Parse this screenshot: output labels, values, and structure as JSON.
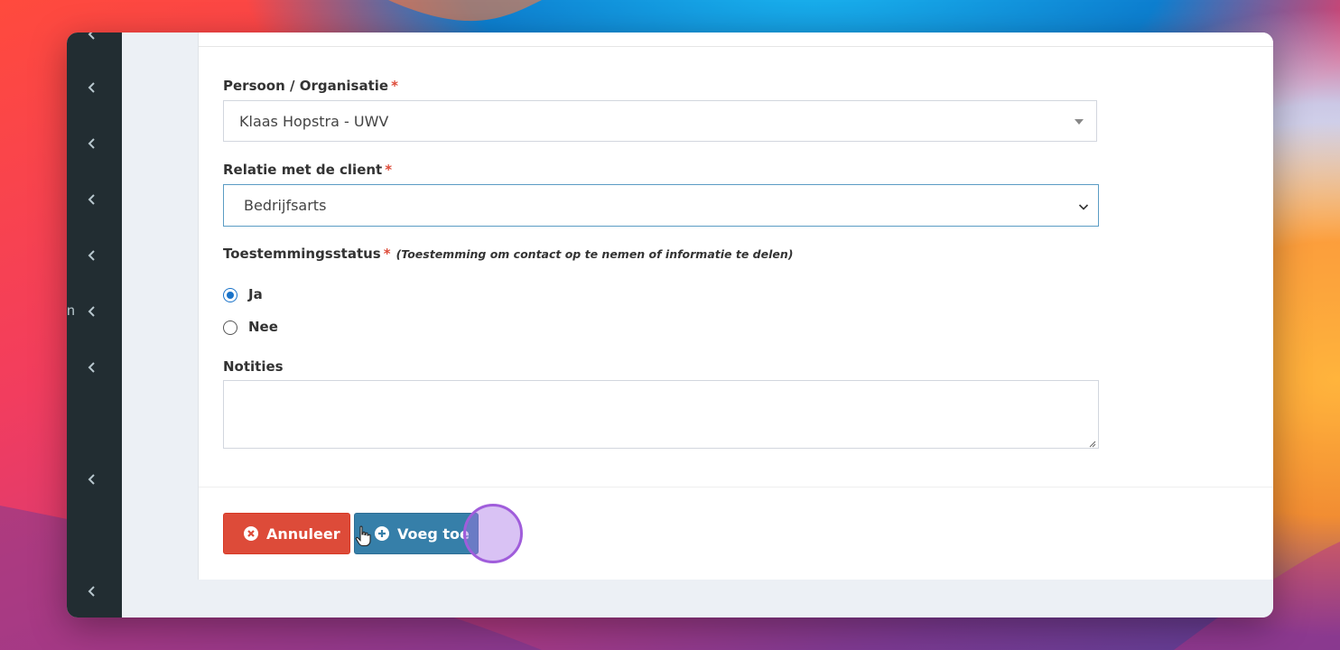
{
  "sidebar": {
    "clipped_text": "n",
    "items": [
      {
        "icon": "chevron-left-icon"
      },
      {
        "icon": "chevron-left-icon"
      },
      {
        "icon": "chevron-left-icon"
      },
      {
        "icon": "chevron-left-icon"
      },
      {
        "icon": "chevron-left-icon"
      },
      {
        "icon": "chevron-left-icon"
      },
      {
        "icon": "chevron-left-icon"
      },
      {
        "icon": "chevron-left-icon"
      },
      {
        "icon": "chevron-left-icon"
      }
    ]
  },
  "form": {
    "person": {
      "label": "Persoon / Organisatie",
      "required_marker": "*",
      "value": "Klaas Hopstra - UWV"
    },
    "relation": {
      "label": "Relatie met de client",
      "required_marker": "*",
      "value": "Bedrijfsarts"
    },
    "consent": {
      "label": "Toestemmingsstatus",
      "required_marker": "*",
      "hint": "(Toestemming om contact op te nemen of informatie te delen)",
      "options": [
        {
          "label": "Ja",
          "checked": true
        },
        {
          "label": "Nee",
          "checked": false
        }
      ]
    },
    "notes": {
      "label": "Notities",
      "value": ""
    }
  },
  "actions": {
    "cancel_label": "Annuleer",
    "add_label": "Voeg toe"
  },
  "colors": {
    "sidebar_bg": "#222d32",
    "cancel": "#dd4b39",
    "primary": "#367fa9",
    "required": "#dd4b39",
    "radio_checked": "#1a73c9"
  }
}
